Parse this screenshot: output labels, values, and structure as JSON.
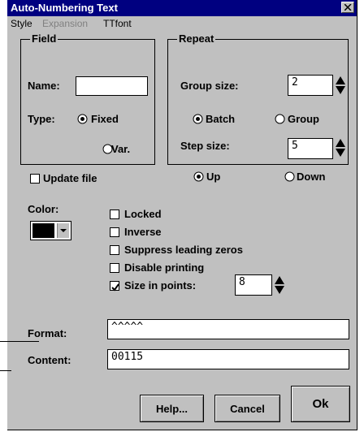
{
  "window": {
    "title": "Auto-Numbering Text"
  },
  "menu": {
    "style": "Style",
    "expansion": "Expansion",
    "ttfont": "TTfont"
  },
  "field": {
    "legend": "Field",
    "name_label": "Name:",
    "name_value": "",
    "type_label": "Type:",
    "fixed_label": "Fixed",
    "var_label": "Var.",
    "selected_type": "Fixed",
    "update_file_label": "Update file",
    "update_file_checked": false
  },
  "repeat": {
    "legend": "Repeat",
    "group_size_label": "Group size:",
    "group_size_value": "2",
    "batch_label": "Batch",
    "group_label": "Group",
    "selected_mode": "Batch",
    "step_size_label": "Step size:",
    "step_size_value": "5",
    "up_label": "Up",
    "down_label": "Down",
    "selected_direction": "Up"
  },
  "color": {
    "label": "Color:",
    "value": "#000000"
  },
  "options": {
    "locked": {
      "label": "Locked",
      "checked": false
    },
    "inverse": {
      "label": "Inverse",
      "checked": false
    },
    "suppress": {
      "label": "Suppress leading zeros",
      "checked": false
    },
    "disable_printing": {
      "label": "Disable printing",
      "checked": false
    },
    "size_in_points": {
      "label": "Size in points:",
      "checked": true,
      "value": "8"
    }
  },
  "format": {
    "label": "Format:",
    "value": "^^^^^"
  },
  "content": {
    "label": "Content:",
    "value": "00115"
  },
  "buttons": {
    "help": "Help...",
    "cancel": "Cancel",
    "ok": "Ok"
  }
}
